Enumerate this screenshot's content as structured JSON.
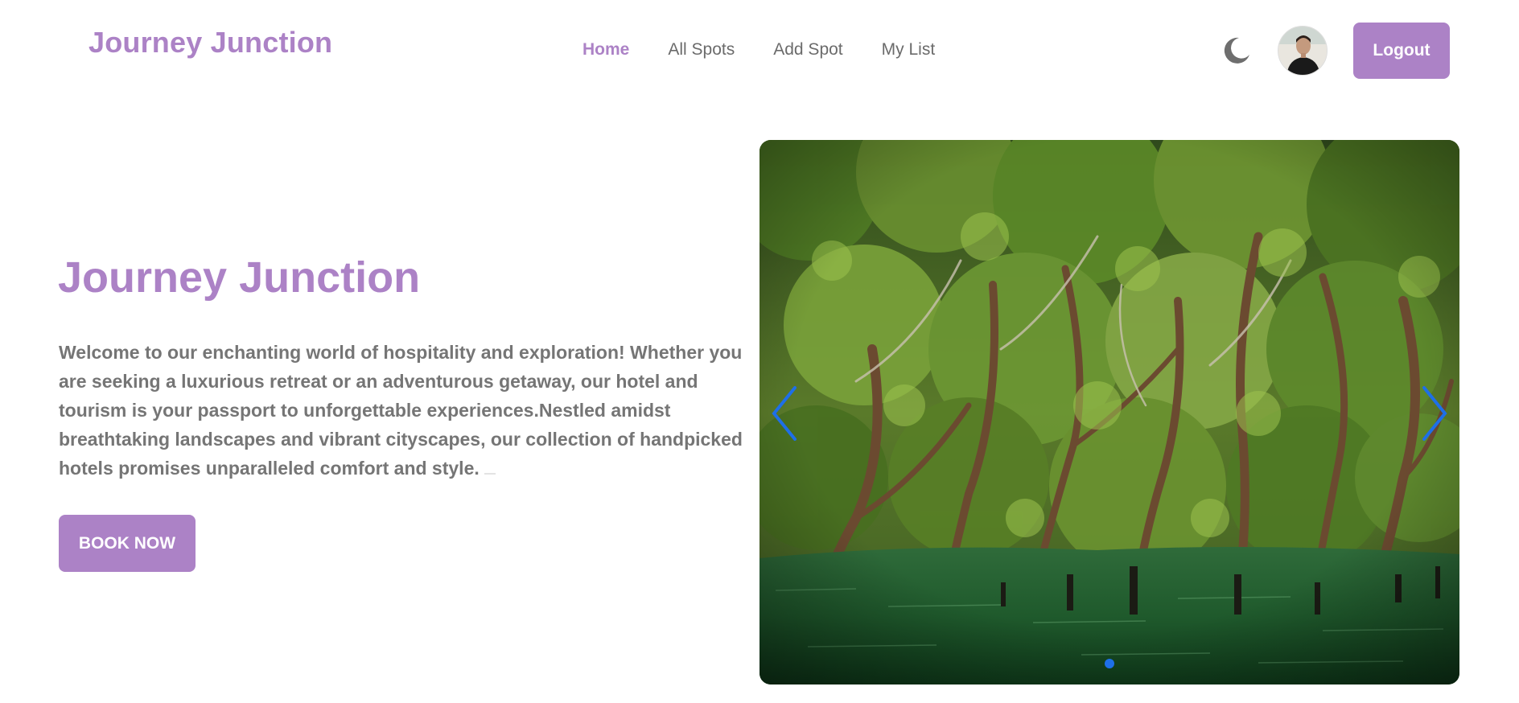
{
  "header": {
    "logo": "Journey Junction",
    "nav": [
      {
        "label": "Home",
        "active": true
      },
      {
        "label": "All Spots",
        "active": false
      },
      {
        "label": "Add Spot",
        "active": false
      },
      {
        "label": "My List",
        "active": false
      }
    ],
    "theme_icon": "moon-icon",
    "logout_label": "Logout"
  },
  "hero": {
    "title": "Journey Junction",
    "description": "Welcome to our enchanting world of hospitality and exploration! Whether you are seeking a luxurious retreat or an adventurous getaway, our hotel and tourism is your passport to unforgettable experiences.Nestled amidst breathtaking landscapes and vibrant cityscapes, our collection of handpicked hotels promises unparalleled comfort and style.",
    "cta_label": "BOOK NOW"
  },
  "carousel": {
    "prev_icon": "chevron-left-icon",
    "next_icon": "chevron-right-icon",
    "slide_count": 1,
    "active_slide": 1
  },
  "colors": {
    "brand": "#ac82c6",
    "text_muted": "#757575",
    "carousel_accent": "#1e6fe8"
  }
}
